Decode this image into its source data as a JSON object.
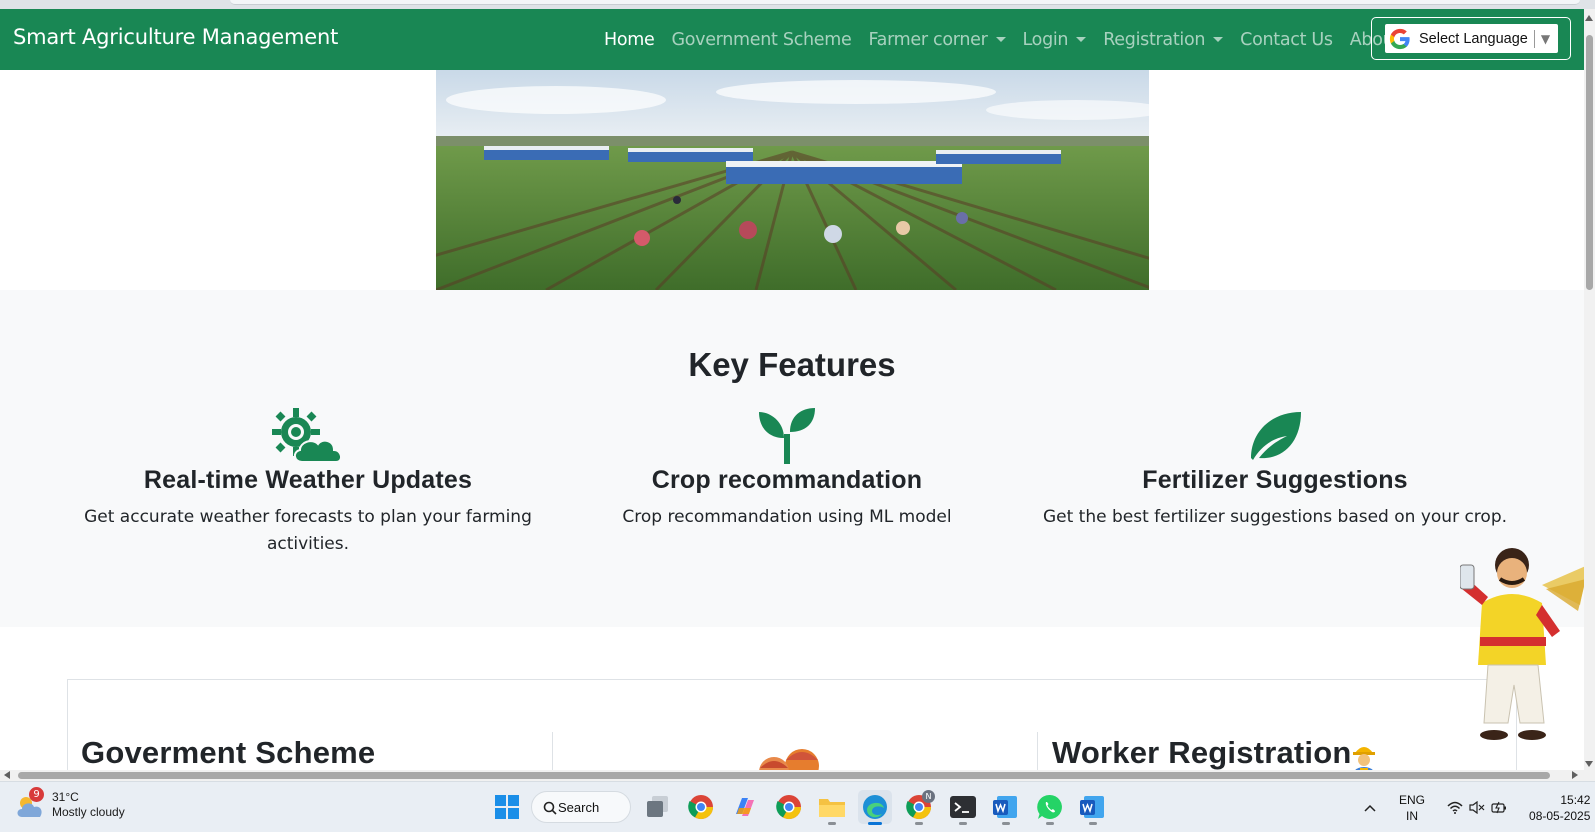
{
  "navbar": {
    "brand": "Smart Agriculture Management",
    "links": [
      {
        "label": "Home",
        "active": true,
        "dropdown": false
      },
      {
        "label": "Government Scheme",
        "active": false,
        "dropdown": false
      },
      {
        "label": "Farmer corner",
        "active": false,
        "dropdown": true
      },
      {
        "label": "Login",
        "active": false,
        "dropdown": true
      },
      {
        "label": "Registration",
        "active": false,
        "dropdown": true
      },
      {
        "label": "Contact Us",
        "active": false,
        "dropdown": false
      },
      {
        "label": "About",
        "active": false,
        "dropdown": false
      }
    ],
    "language_select": "Select Language",
    "language_arrow": "▼"
  },
  "features": {
    "title": "Key Features",
    "items": [
      {
        "icon": "weather-icon",
        "title": "Real-time Weather Updates",
        "description": "Get accurate weather forecasts to plan your farming activities."
      },
      {
        "icon": "seedling-icon",
        "title": "Crop recommandation",
        "description": "Crop recommandation using ML model"
      },
      {
        "icon": "leaf-icon",
        "title": "Fertilizer Suggestions",
        "description": "Get the best fertilizer suggestions based on your crop."
      }
    ]
  },
  "lower": {
    "scheme_title": "Goverment Scheme",
    "worker_title": "Worker Registration"
  },
  "taskbar": {
    "weather_badge": "9",
    "temperature": "31°C",
    "condition": "Mostly cloudy",
    "search_label": "Search",
    "language_line1": "ENG",
    "language_line2": "IN",
    "time": "15:42",
    "date": "08-05-2025",
    "chrome_badge": "N"
  },
  "colors": {
    "navbar": "#198754",
    "icon_green": "#198754",
    "features_bg": "#f8f9fa"
  }
}
